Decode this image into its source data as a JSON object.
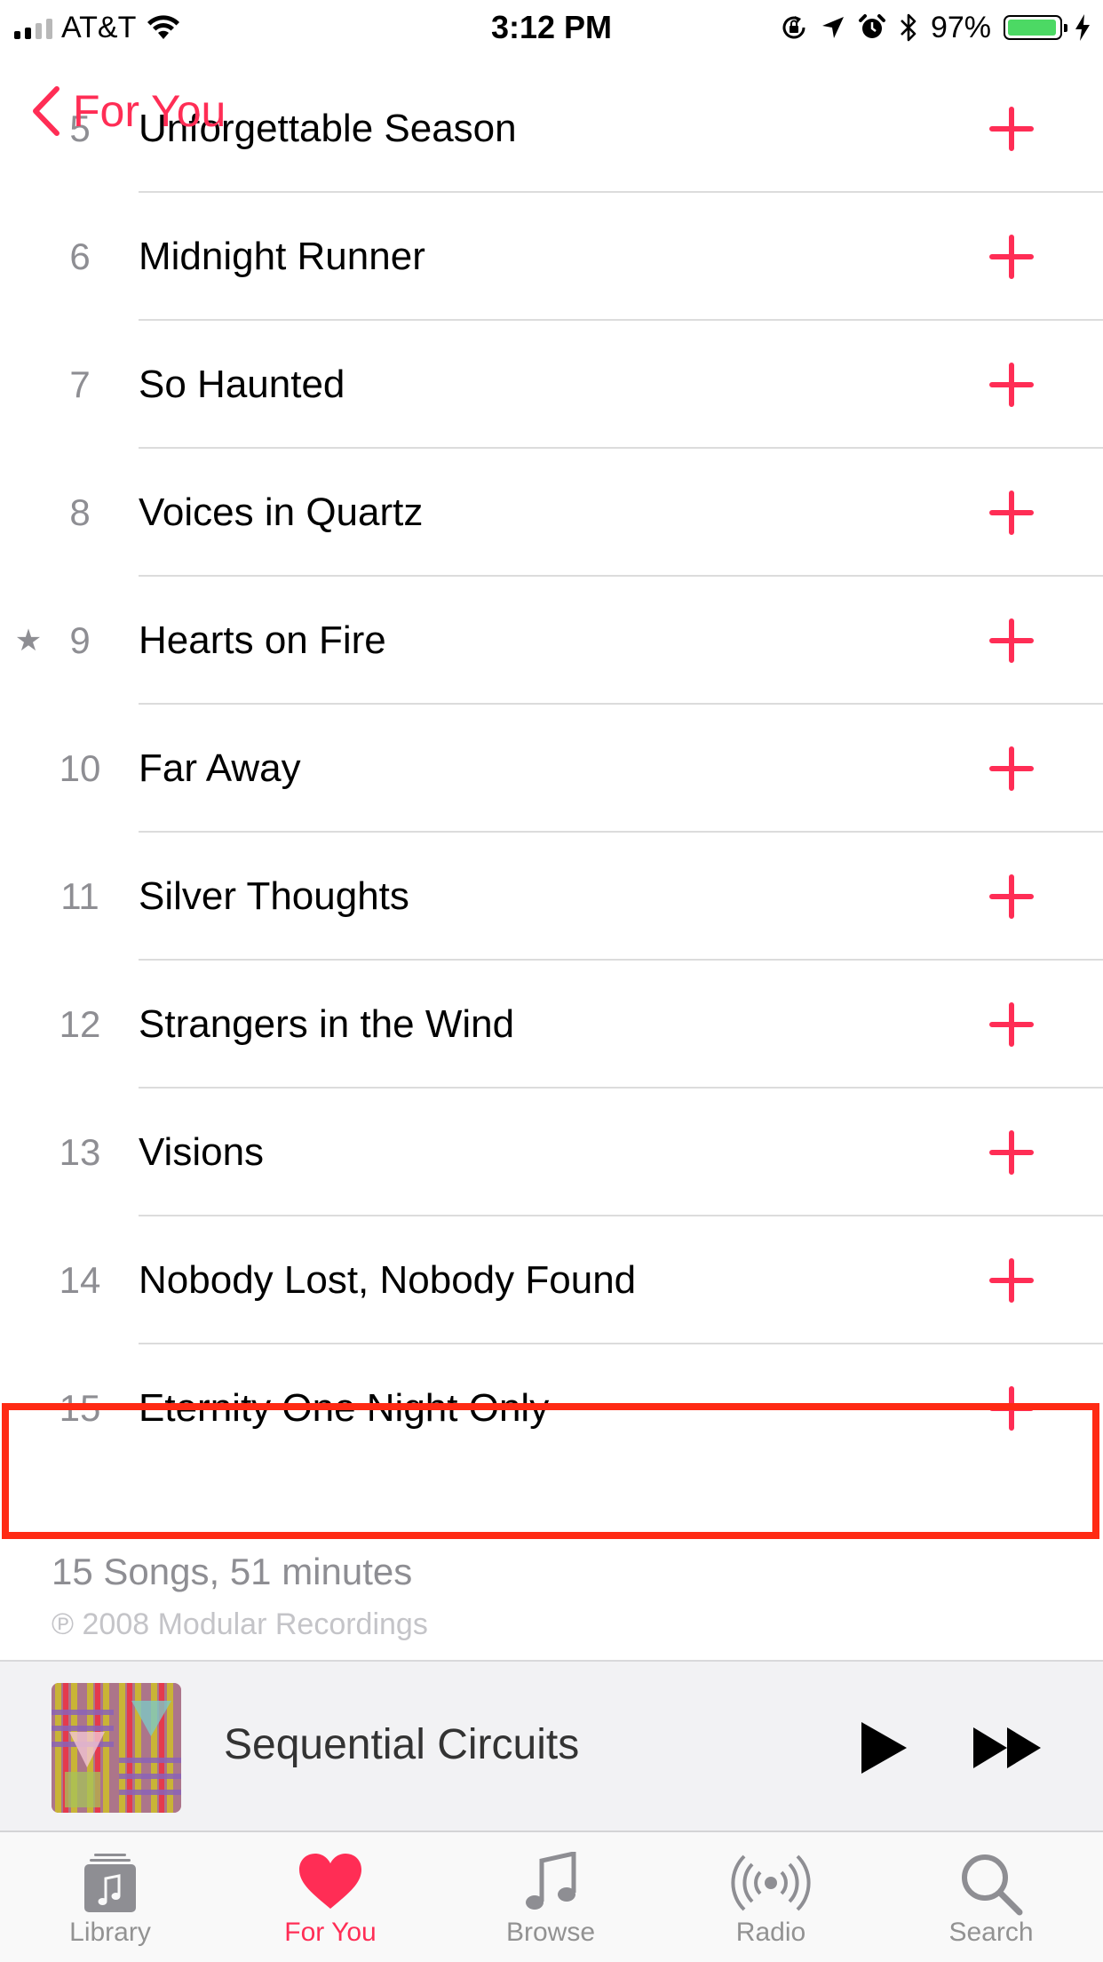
{
  "status_bar": {
    "carrier": "AT&T",
    "time": "3:12 PM",
    "battery_percent": "97%",
    "battery_level": 0.97,
    "signal_bars_filled": 2,
    "icons": [
      "wifi-icon",
      "orientation-lock-icon",
      "location-icon",
      "alarm-icon",
      "bluetooth-icon",
      "charging-icon"
    ]
  },
  "nav": {
    "back_label": "For You"
  },
  "tracks": [
    {
      "number": "5",
      "title": "Unforgettable Season",
      "starred": false
    },
    {
      "number": "6",
      "title": "Midnight Runner",
      "starred": false
    },
    {
      "number": "7",
      "title": "So Haunted",
      "starred": false
    },
    {
      "number": "8",
      "title": "Voices in Quartz",
      "starred": false
    },
    {
      "number": "9",
      "title": "Hearts on Fire",
      "starred": true
    },
    {
      "number": "10",
      "title": "Far Away",
      "starred": false
    },
    {
      "number": "11",
      "title": "Silver Thoughts",
      "starred": false
    },
    {
      "number": "12",
      "title": "Strangers in the Wind",
      "starred": false
    },
    {
      "number": "13",
      "title": "Visions",
      "starred": false
    },
    {
      "number": "14",
      "title": "Nobody Lost, Nobody Found",
      "starred": false
    },
    {
      "number": "15",
      "title": "Eternity One Night Only",
      "starred": false
    }
  ],
  "highlighted_track": "15",
  "album_info": {
    "summary": "15 Songs, 51 minutes",
    "copyright": "℗ 2008 Modular Recordings"
  },
  "now_playing": {
    "title": "Sequential Circuits"
  },
  "tabs": [
    {
      "id": "library",
      "label": "Library",
      "icon": "library-icon",
      "active": false
    },
    {
      "id": "for-you",
      "label": "For You",
      "icon": "heart-icon",
      "active": true
    },
    {
      "id": "browse",
      "label": "Browse",
      "icon": "music-note-icon",
      "active": false
    },
    {
      "id": "radio",
      "label": "Radio",
      "icon": "radio-icon",
      "active": false
    },
    {
      "id": "search",
      "label": "Search",
      "icon": "search-icon",
      "active": false
    }
  ],
  "colors": {
    "accent": "#ff2d55",
    "highlight_box": "#ff2a14",
    "secondary_text": "#8e8e93",
    "battery": "#4cd964",
    "inactive_tab": "#929292"
  }
}
